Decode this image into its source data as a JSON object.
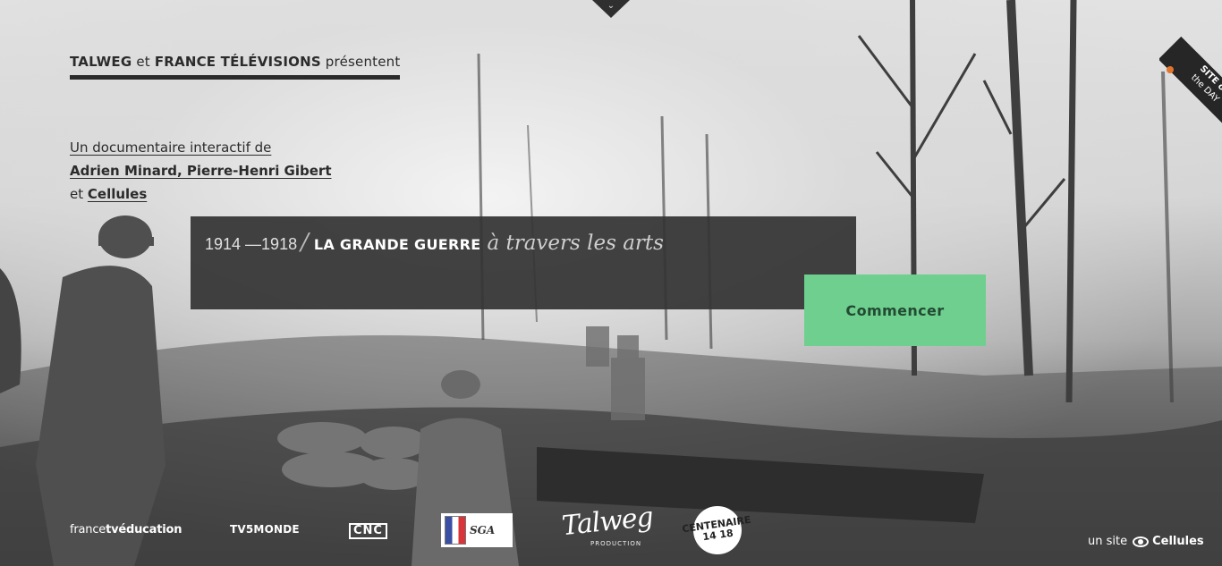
{
  "header": {
    "presents_a": "TALWEG",
    "presents_et": " et ",
    "presents_b": "FRANCE TÉLÉVISIONS",
    "presents_suffix": " présentent"
  },
  "credits": {
    "line1": "Un documentaire interactif de",
    "authors": "Adrien Minard, Pierre-Henri Gibert",
    "and": "et ",
    "studio": "Cellules"
  },
  "title": {
    "dates": "1914 —1918",
    "main": "LA GRANDE GUERRE",
    "subtitle": "à travers les arts"
  },
  "cta": {
    "start_label": "Commencer"
  },
  "badge": {
    "line1": "SITE of",
    "line2": "the DAY"
  },
  "partners": {
    "ftv_a": "france",
    "ftv_b": "tv",
    "ftv_c": "éducation",
    "tv5": "TV5MONDE",
    "cnc": "CNC",
    "sga": "SGA",
    "talweg": "Talweg",
    "talweg_sub": "PRODUCTION",
    "centenaire": "CENTENAIRE 14 18"
  },
  "footer": {
    "un_site": "un site",
    "brand": "Cellules"
  },
  "colors": {
    "accent": "#6ecf8f",
    "panel": "#343434",
    "text_dark": "#2b2b2b"
  },
  "icons": {
    "toggle": "chevron-down-icon",
    "footer_brand": "eye-icon"
  }
}
